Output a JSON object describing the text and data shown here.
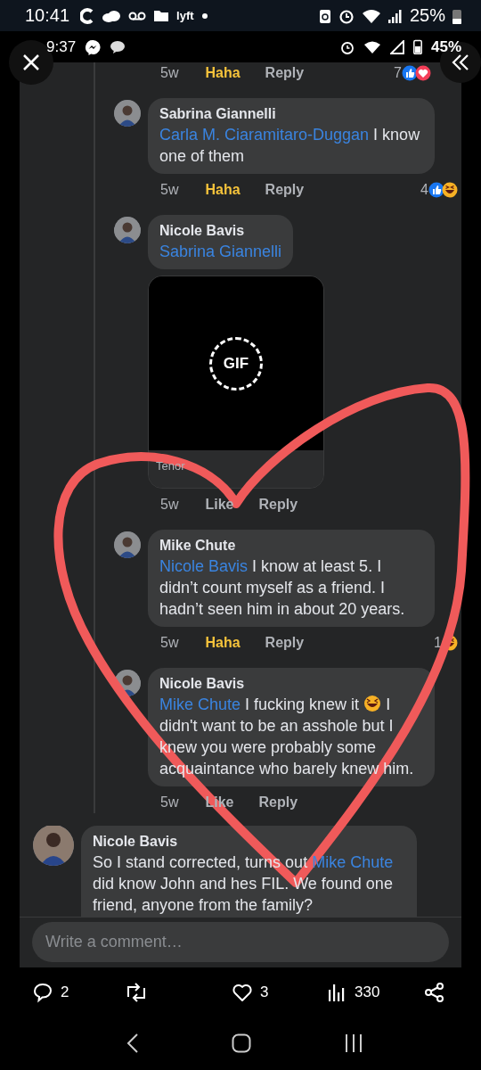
{
  "device_status": {
    "time": "10:41",
    "carrier_logo": "lyft",
    "battery": "25%"
  },
  "screenshot_status": {
    "time": "9:37",
    "battery": "45%"
  },
  "comments": [
    {
      "kind": "actions_only",
      "time": "5w",
      "reaction_label": "Haha",
      "reacted": true,
      "reply_label": "Reply",
      "reaction_count": "7",
      "reactions": [
        {
          "kind": "like"
        },
        {
          "kind": "love"
        }
      ]
    },
    {
      "kind": "reply",
      "author": "Sabrina Giannelli",
      "mention": "Carla M. Ciaramitaro-Duggan",
      "parts": [
        {
          "kind": "text",
          "text": "I know one of them"
        }
      ],
      "time": "5w",
      "reaction_label": "Haha",
      "reacted": true,
      "reply_label": "Reply",
      "reaction_count": "4",
      "reactions": [
        {
          "kind": "like"
        },
        {
          "kind": "haha"
        }
      ]
    },
    {
      "kind": "reply",
      "author": "Nicole Bavis",
      "mention": "Sabrina Giannelli",
      "attachment": {
        "badge": "GIF",
        "source": "Tenor"
      },
      "time": "5w",
      "reaction_label": "Like",
      "reacted": false,
      "reply_label": "Reply"
    },
    {
      "kind": "reply",
      "author": "Mike Chute",
      "mention": "Nicole Bavis",
      "parts": [
        {
          "kind": "text",
          "text": "I know at least 5. I didn’t count myself as a friend. I hadn’t seen him in about 20 years."
        }
      ],
      "time": "5w",
      "reaction_label": "Haha",
      "reacted": true,
      "reply_label": "Reply",
      "reaction_count": "1",
      "reactions": [
        {
          "kind": "haha"
        }
      ]
    },
    {
      "kind": "reply",
      "author": "Nicole Bavis",
      "mention": "Mike Chute",
      "parts": [
        {
          "kind": "text",
          "text": "I fucking knew it"
        },
        {
          "kind": "emoji"
        },
        {
          "kind": "text",
          "text": "I didn't want to be an asshole but I knew you were probably some acquaintance who barely knew him."
        }
      ],
      "time": "5w",
      "reaction_label": "Like",
      "reacted": false,
      "reply_label": "Reply"
    },
    {
      "kind": "top",
      "author": "Nicole Bavis",
      "parts": [
        {
          "kind": "text",
          "text": "So I stand corrected, turns out"
        },
        {
          "kind": "mention",
          "text": "Mike Chute"
        },
        {
          "kind": "text",
          "text": "did know John and hes FIL. We found one friend, anyone from the family?"
        }
      ]
    }
  ],
  "composer": {
    "placeholder": "Write a comment…"
  },
  "post_actions": {
    "replies": "2",
    "likes": "3",
    "views": "330"
  }
}
